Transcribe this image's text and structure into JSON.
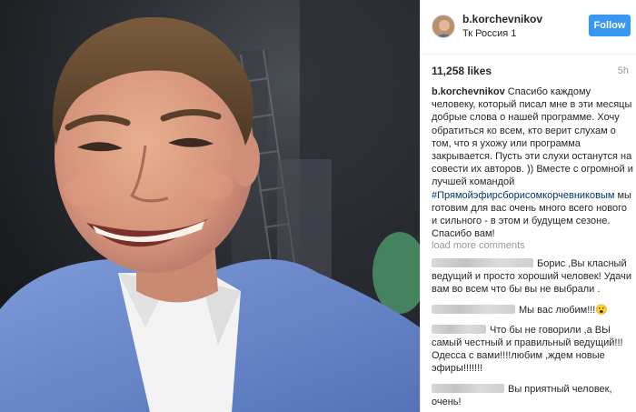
{
  "post": {
    "username": "b.korchevnikov",
    "location": "Тк Россия 1",
    "follow_label": "Follow",
    "likes": "11,258 likes",
    "time": "5h",
    "caption_user": "b.korchevnikov",
    "caption_text_1": "Спасибо каждому человеку, который писал мне в эти месяцы добрые слова о нашей программе. Хочу обратиться ко всем, кто верит слухам о том, что я ухожу или программа закрывается. Пусть эти слухи останутся на совести их авторов. )) Вместе с огромной и лучшей командой",
    "hashtag": "#Прямойэфирсборисомкорчевниковым",
    "caption_text_2": "мы готовим для вас очень много всего нового и сильного - в этом и будущем сезоне. Спасибо вам!",
    "load_more": "load more comments"
  },
  "comments": [
    {
      "text": "Борис ,Вы класный ведущий и просто хороший человек! Удачи вам во всем что бы вы не выбрали ."
    },
    {
      "text": "Мы вас любим!!!😮"
    },
    {
      "text": "Что бы не говорили ,а ВЫ самый честный и правильный ведущий!!! Одесса с вами!!!!любим ,ждем новые эфиры!!!!!!!"
    },
    {
      "text": "Вы приятный человек, очень!"
    }
  ],
  "colors": {
    "follow_button": "#3897f0",
    "hashtag": "#003569",
    "muted_text": "#999999",
    "jacket": "#6f8fcf"
  },
  "icons": {
    "avatar": "profile-avatar-icon"
  }
}
